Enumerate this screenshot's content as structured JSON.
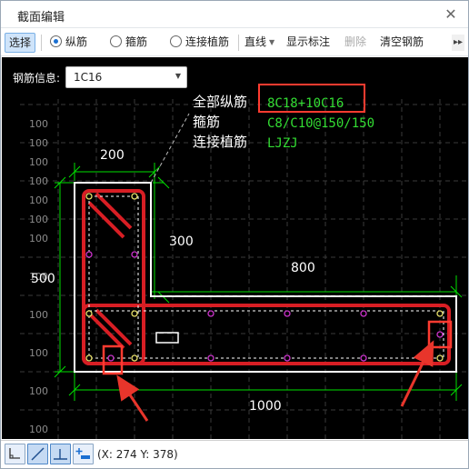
{
  "window": {
    "title": "截面编辑",
    "close_glyph": "✕"
  },
  "toolbar": {
    "select": "选择",
    "modes": [
      {
        "label": "纵筋",
        "selected": true
      },
      {
        "label": "箍筋",
        "selected": false
      },
      {
        "label": "连接植筋",
        "selected": false
      }
    ],
    "line": "直线",
    "show_label": "显示标注",
    "delete": "删除",
    "clear": "清空钢筋",
    "more_glyph": "▸▸"
  },
  "rebar_info": {
    "label": "钢筋信息:",
    "value": "1C16"
  },
  "annotation": {
    "rows": [
      {
        "name": "全部纵筋",
        "value": "8C18+10C16"
      },
      {
        "name": "箍筋",
        "value": "C8/C10@150/150"
      },
      {
        "name": "连接植筋",
        "value": "LJZJ"
      }
    ]
  },
  "dimensions": {
    "top_width": "200",
    "inner_height": "300",
    "arm_length": "800",
    "total_height": "500",
    "total_length": "1000"
  },
  "grid_labels": [
    "100",
    "100",
    "100",
    "100",
    "100",
    "100",
    "100",
    "100",
    "100",
    "100",
    "100",
    "100",
    "100"
  ],
  "status": {
    "coords": "(X: 274 Y: 378)"
  },
  "colors": {
    "canvas": "#000000",
    "dim": "#00e000",
    "section": "#ffffff",
    "rebar": "#d81e24",
    "highlight": "#ff3b30",
    "dots": "#cc33cc",
    "label_value": "#33dd33"
  }
}
